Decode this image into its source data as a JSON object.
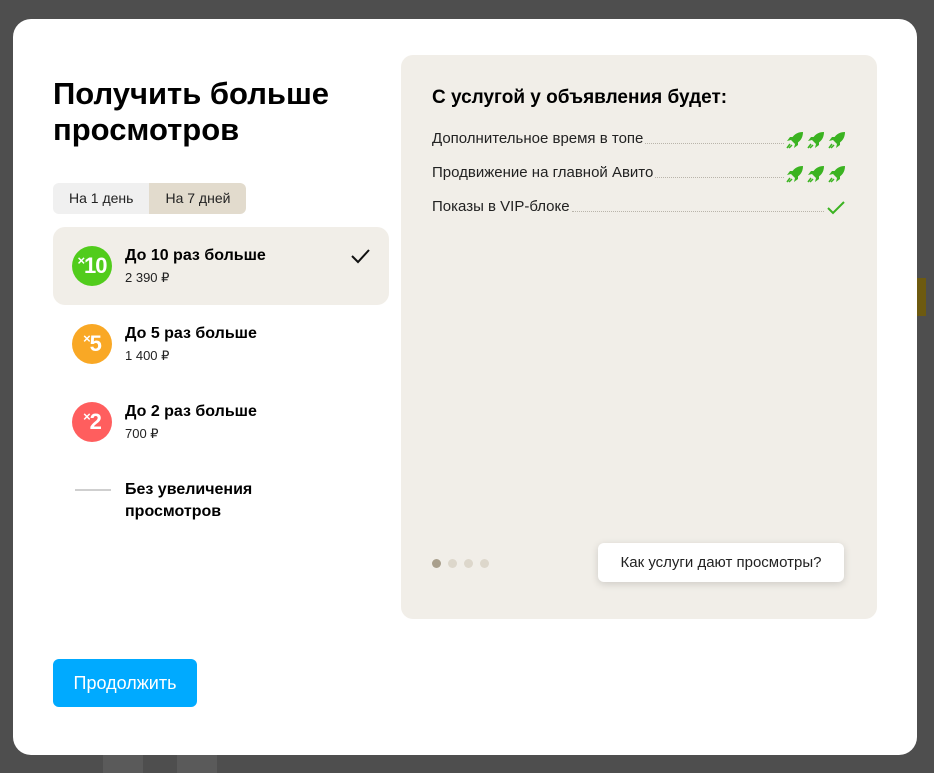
{
  "modal": {
    "title": "Получить больше просмотров",
    "period_tabs": [
      {
        "label": "На 1 день",
        "active": false
      },
      {
        "label": "На 7 дней",
        "active": true
      }
    ],
    "options": [
      {
        "badge": "10",
        "color": "#51cc1c",
        "name": "До 10 раз больше",
        "price": "2 390 ₽",
        "selected": true
      },
      {
        "badge": "5",
        "color": "#f9a825",
        "name": "До 5 раз больше",
        "price": "1 400 ₽",
        "selected": false
      },
      {
        "badge": "2",
        "color": "#ff5e5e",
        "name": "До 2 раз больше",
        "price": "700 ₽",
        "selected": false
      }
    ],
    "none_option": "Без увеличения просмотров",
    "continue_label": "Продолжить"
  },
  "panel": {
    "title": "С услугой у объявления будет:",
    "features": [
      {
        "label": "Дополнительное время в топе",
        "icon": "rocket-icon",
        "count": 3
      },
      {
        "label": "Продвижение на главной Авито",
        "icon": "rocket-icon",
        "count": 3
      },
      {
        "label": "Показы в VIP-блоке",
        "icon": "check-icon",
        "count": 1
      }
    ],
    "pager": {
      "total": 4,
      "active": 0
    },
    "how_button": "Как услуги дают просмотры?"
  },
  "colors": {
    "accent": "#00aaff",
    "panel_bg": "#f1eee8",
    "rocket": "#3bb321"
  }
}
